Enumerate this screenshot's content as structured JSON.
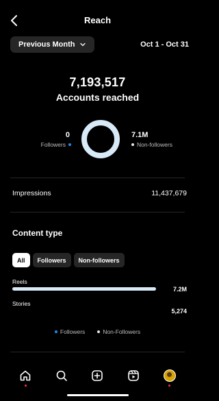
{
  "header": {
    "title": "Reach"
  },
  "filters": {
    "period": "Previous Month",
    "range": "Oct 1 - Oct 31"
  },
  "summary": {
    "accounts_reached": "7,193,517",
    "accounts_reached_label": "Accounts reached",
    "followers_value": "0",
    "followers_label": "Followers",
    "non_followers_value": "7.1M",
    "non_followers_label": "Non-followers",
    "followers_share": 0
  },
  "impressions": {
    "label": "Impressions",
    "value": "11,437,679"
  },
  "content_type": {
    "title": "Content type",
    "chips": [
      {
        "label": "All",
        "active": true
      },
      {
        "label": "Followers",
        "active": false
      },
      {
        "label": "Non-followers",
        "active": false
      }
    ],
    "rows": [
      {
        "label": "Reels",
        "value": "7.2M",
        "fraction": 1.0
      },
      {
        "label": "Stories",
        "value": "5,274",
        "fraction": 0.0007
      }
    ],
    "legend": [
      "Followers",
      "Non-Followers"
    ]
  },
  "nav": [
    "home-icon",
    "search-icon",
    "create-icon",
    "reels-icon",
    "profile-avatar"
  ],
  "colors": {
    "accent": "#1f8cf0",
    "ring": "#d8e9f7",
    "chip_bg": "#262626",
    "notification": "#ff3040"
  }
}
